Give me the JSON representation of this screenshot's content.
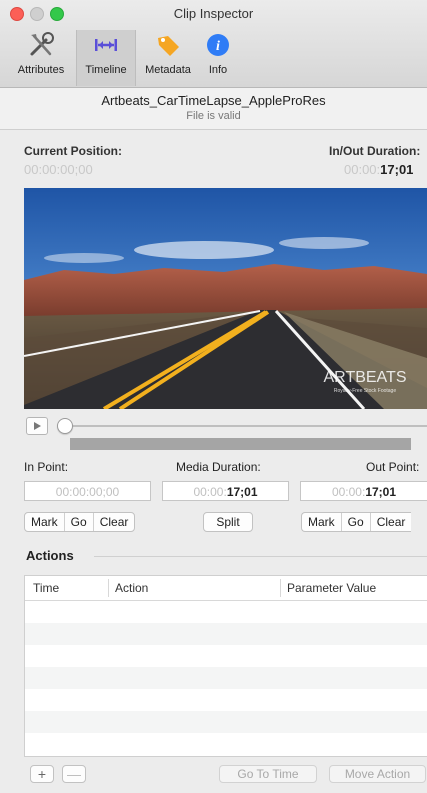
{
  "window": {
    "title": "Clip Inspector"
  },
  "toolbar": {
    "items": [
      {
        "label": "Attributes",
        "icon": "tools-icon"
      },
      {
        "label": "Timeline",
        "icon": "timeline-icon",
        "selected": true
      },
      {
        "label": "Metadata",
        "icon": "tag-icon"
      },
      {
        "label": "Info",
        "icon": "info-icon"
      }
    ]
  },
  "clip": {
    "name": "Artbeats_CarTimeLapse_AppleProRes",
    "status": "File is valid"
  },
  "position": {
    "current_label": "Current Position:",
    "current_value": "00:00:00;00",
    "inout_label": "In/Out Duration:",
    "inout_prefix": "00:00:",
    "inout_bold": "17;01"
  },
  "video": {
    "watermark": "ARTBEATS",
    "watermark_sub": "Royalty-Free Stock Footage"
  },
  "playback": {
    "progress": 0.0
  },
  "points": {
    "in_label": "In Point:",
    "in_value": "00:00:00;00",
    "media_label": "Media Duration:",
    "media_prefix": "00:00:",
    "media_bold": "17;01",
    "out_label": "Out Point:",
    "out_prefix": "00:00:",
    "out_bold": "17;01"
  },
  "buttons": {
    "mark": "Mark",
    "go": "Go",
    "clear": "Clear",
    "split": "Split",
    "add": "+",
    "remove": "—",
    "go_to_time": "Go To Time",
    "move_action": "Move Action"
  },
  "actions": {
    "title": "Actions",
    "columns": [
      "Time",
      "Action",
      "Parameter Value"
    ],
    "rows": []
  },
  "colors": {
    "accent": "#5a4fd8",
    "close": "#fc5f57",
    "maximize": "#34c84a",
    "info": "#2f7cf6",
    "tag": "#f5a623"
  }
}
